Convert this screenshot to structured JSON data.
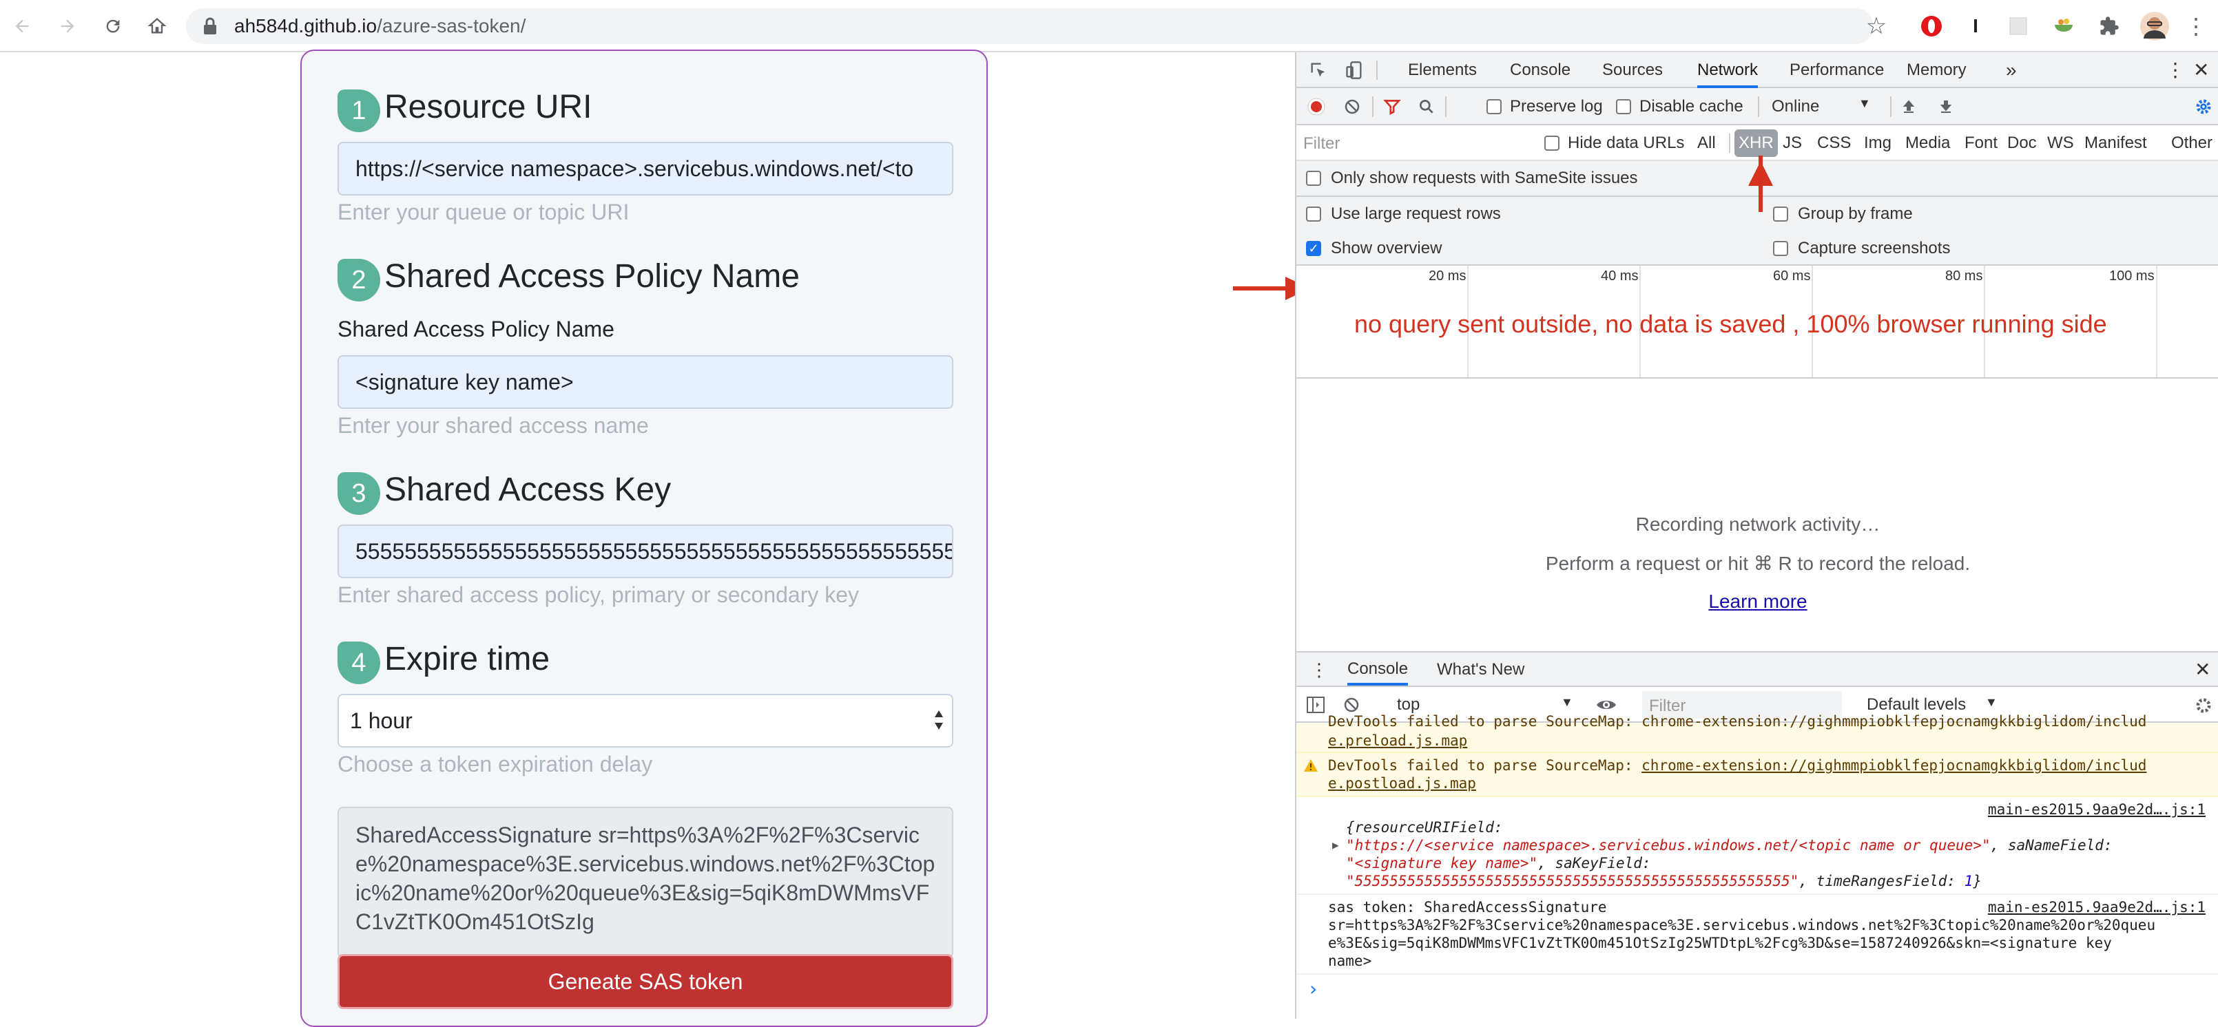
{
  "browser": {
    "url_host": "ah584d.github.io",
    "url_path": "/azure-sas-token/"
  },
  "form": {
    "step1": {
      "number": "1",
      "title": "Resource URI",
      "value": "https://<service namespace>.servicebus.windows.net/<to",
      "help": "Enter your queue or topic URI"
    },
    "step2": {
      "number": "2",
      "title": "Shared Access Policy Name",
      "label": "Shared Access Policy Name",
      "value": "<signature key name>",
      "help": "Enter your shared access name"
    },
    "step3": {
      "number": "3",
      "title": "Shared Access Key",
      "value": "5555555555555555555555555555555555555555555555555",
      "help": "Enter shared access policy, primary or secondary key"
    },
    "step4": {
      "number": "4",
      "title": "Expire time",
      "selected": "1 hour",
      "help": "Choose a token expiration delay"
    },
    "output": "SharedAccessSignature sr=https%3A%2F%2F%3Cservice%20namespace%3E.servicebus.windows.net%2F%3Ctopic%20name%20or%20queue%3E&sig=5qiK8mDWMmsVFC1vZtTK0Om451OtSzIg",
    "button": "Geneate SAS token"
  },
  "devtools": {
    "tabs": [
      "Elements",
      "Console",
      "Sources",
      "Network",
      "Performance",
      "Memory"
    ],
    "active_tab": "Network",
    "toolbar": {
      "preserve_log": "Preserve log",
      "disable_cache": "Disable cache",
      "throttle": "Online"
    },
    "filter": {
      "placeholder": "Filter",
      "hide_data_urls": "Hide data URLs",
      "types": [
        "All",
        "XHR",
        "JS",
        "CSS",
        "Img",
        "Media",
        "Font",
        "Doc",
        "WS",
        "Manifest",
        "Other"
      ]
    },
    "options": {
      "samesite": "Only show requests with SameSite issues",
      "large_rows": "Use large request rows",
      "group_by_frame": "Group by frame",
      "show_overview": "Show overview",
      "capture_screenshots": "Capture screenshots"
    },
    "timeline": [
      "20 ms",
      "40 ms",
      "60 ms",
      "80 ms",
      "100 ms"
    ],
    "annotation": "no query sent outside, no data is saved , 100% browser running side",
    "empty": {
      "line1": "Recording network activity…",
      "line2": "Perform a request or hit ⌘ R to record the reload.",
      "learn_more": "Learn more"
    },
    "drawer": {
      "tabs": [
        "Console",
        "What's New"
      ],
      "context": "top",
      "filter_placeholder": "Filter",
      "levels": "Default levels"
    },
    "console": {
      "warn1_tail": "e.preload.js.map",
      "warn1_head": "DevTools failed to parse SourceMap: chrome-extension://gighmmpiobklfepjocnamgkkbiglidom/includ",
      "warn2_prefix": "DevTools failed to parse SourceMap: ",
      "warn2_link1": "chrome-extension://gighmmpiobklfepjocnamgkkbiglidom/includ",
      "warn2_link2": "e.postload.js.map",
      "log1_source": "main-es2015.9aa9e2d….js:1",
      "log1_l1_key": "{resourceURIField:",
      "log1_l2": "\"https://<service namespace>.servicebus.windows.net/<topic name or queue>\"",
      "log1_l2_key": ", saNameField:",
      "log1_l3": "\"<signature key name>\"",
      "log1_l3_key": ", saKeyField:",
      "log1_l4": "\"55555555555555555555555555555555555555555555555555\"",
      "log1_l4_key": ", timeRangesField: ",
      "log1_l4_num": "1",
      "log1_l4_end": "}",
      "log2_source": "main-es2015.9aa9e2d….js:1",
      "log2_l1": "sas token: SharedAccessSignature",
      "log2_l2": "sr=https%3A%2F%2F%3Cservice%20namespace%3E.servicebus.windows.net%2F%3Ctopic%20name%20or%20queu",
      "log2_l3": "e%3E&sig=5qiK8mDWMmsVFC1vZtTK0Om451OtSzIg25WTDtpL%2Fcg%3D&se=1587240926&skn=<signature key",
      "log2_l4": "name>",
      "prompt": "›"
    }
  },
  "colors": {
    "accent_green": "#5ab39a",
    "button_red": "#bf3232",
    "annotation_red": "#d5321f",
    "card_border": "#9c4fb9"
  }
}
